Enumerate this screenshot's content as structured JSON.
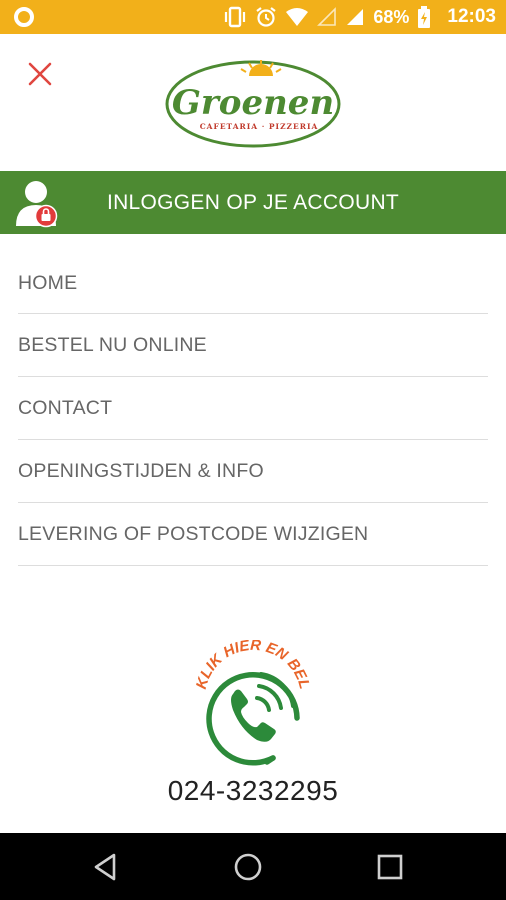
{
  "status_bar": {
    "battery_percent": "68%",
    "time": "12:03",
    "icons": [
      "notification-dot-icon",
      "vibrate-icon",
      "alarm-icon",
      "wifi-icon",
      "signal-empty-icon",
      "signal-icon",
      "battery-charging-icon"
    ]
  },
  "header": {
    "close_icon": "close-icon",
    "logo": {
      "brand": "Groenen",
      "tagline": "CAFETARIA · PIZZERIA"
    }
  },
  "account": {
    "label": "INLOGGEN OP JE ACCOUNT",
    "icon": "user-lock-icon"
  },
  "menu": {
    "items": [
      {
        "label": "HOME"
      },
      {
        "label": "BESTEL NU ONLINE"
      },
      {
        "label": "CONTACT"
      },
      {
        "label": "OPENINGSTIJDEN & INFO"
      },
      {
        "label": "LEVERING OF POSTCODE WIJZIGEN"
      }
    ]
  },
  "call": {
    "caption": "KLIK HIER EN BEL",
    "phone": "024-3232295",
    "icon": "phone-call-icon"
  },
  "colors": {
    "status_bar": "#f2b01a",
    "brand_green": "#4d8a32",
    "close_red": "#e0463f",
    "caption_orange": "#e8652a",
    "menu_text": "#666666"
  },
  "navigation": [
    "back-icon",
    "home-icon",
    "recents-icon"
  ]
}
